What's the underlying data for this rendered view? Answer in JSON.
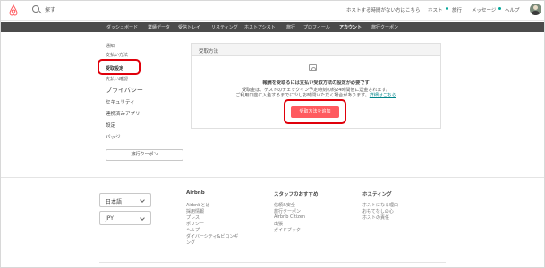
{
  "header": {
    "search_text": "探す",
    "host_prompt": "ホストする時間がない方はこちら",
    "links": [
      "ホスト",
      "旅行",
      "メッセージ",
      "ヘルプ"
    ]
  },
  "nav": {
    "items": [
      "ダッシュボード",
      "業績データ",
      "受信トレイ",
      "リスティング",
      "ホストアシスト",
      "旅行",
      "プロフィール",
      "アカウント",
      "旅行クーポン"
    ],
    "active": "アカウント"
  },
  "sidebar": {
    "items": [
      "通知",
      "支払い方法",
      "受取設定",
      "支払い確認",
      "プライバシー",
      "セキュリティ",
      "連携済みアプリ",
      "設定",
      "バッジ"
    ],
    "selected": "受取設定",
    "coupon_button": "旅行クーポン"
  },
  "panel": {
    "title": "受取方法",
    "heading": "報酬を受取るには支払い受取方法の設定が必要です",
    "line1": "受取金は、ゲストのチェックイン予定時刻の約24時間後に送金されます。",
    "line2_prefix": "ご利用口座に入金するまでに少しお時間いただく場合があります。",
    "more_link": "詳細はこちら",
    "add_button": "受取方法を追加"
  },
  "footer": {
    "language": "日本語",
    "currency": "JPY",
    "columns": [
      {
        "title": "Airbnb",
        "links": [
          "Airbnbとは",
          "採用情報",
          "プレス",
          "ポリシー",
          "ヘルプ",
          "ダイバーシティ&ビロンギ",
          "ング"
        ]
      },
      {
        "title": "スタッフのおすすめ",
        "links": [
          "信頼&安全",
          "旅行クーポン",
          "Airbnb Citizen",
          "出張",
          "ガイドブック"
        ]
      },
      {
        "title": "ホスティング",
        "links": [
          "ホストになる理由",
          "おもてなしの心",
          "ホストの責任"
        ]
      }
    ]
  },
  "colors": {
    "brand": "#ff5a5f",
    "highlight": "#e0000b",
    "nav_bg": "#4b4b4b",
    "link": "#008489"
  }
}
